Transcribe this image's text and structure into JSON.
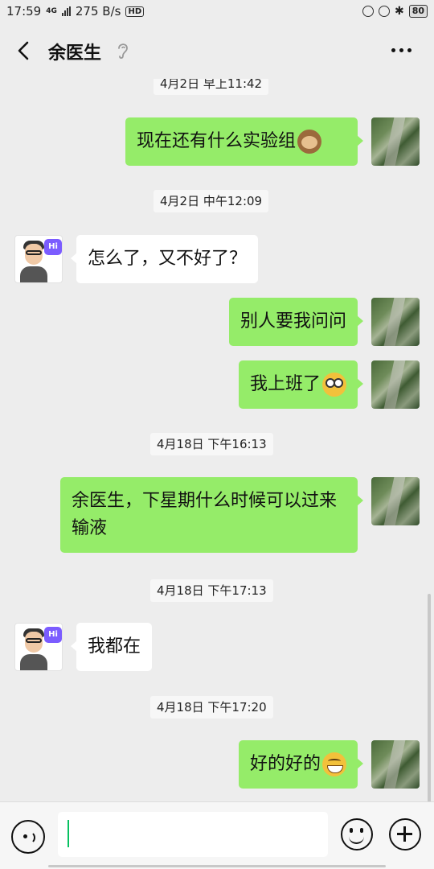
{
  "status_bar": {
    "time": "17:59",
    "network": "4G",
    "speed": "275 B/s",
    "hd": "HD",
    "battery": "80"
  },
  "header": {
    "back_icon": "chevron-left-icon",
    "title": "余医生",
    "ear_icon": "ear-icon",
    "more_icon": "more-dots-icon"
  },
  "messages": [
    {
      "type": "timestamp",
      "text": "4月2日 早上11:42"
    },
    {
      "type": "msg",
      "from": "me",
      "text": "现在还有什么实验组",
      "emoji": "see-no-evil-monkey"
    },
    {
      "type": "timestamp",
      "text": "4月2日 中午12:09"
    },
    {
      "type": "msg",
      "from": "them",
      "text": "怎么了，又不好了？"
    },
    {
      "type": "msg",
      "from": "me",
      "text": "别人要我问问"
    },
    {
      "type": "msg",
      "from": "me",
      "text": "我上班了",
      "emoji": "flushed-face"
    },
    {
      "type": "timestamp",
      "text": "4月18日 下午16:13"
    },
    {
      "type": "msg",
      "from": "me",
      "text": "余医生，下星期什么时候可以过来输液"
    },
    {
      "type": "timestamp",
      "text": "4月18日 下午17:13"
    },
    {
      "type": "msg",
      "from": "them",
      "text": "我都在"
    },
    {
      "type": "timestamp",
      "text": "4月18日 下午17:20"
    },
    {
      "type": "msg",
      "from": "me",
      "text": "好的好的",
      "emoji": "grinning-face"
    }
  ],
  "avatar_badge": "Hi",
  "input_bar": {
    "voice_icon": "voice-icon",
    "text_value": "",
    "emoji_icon": "emoji-icon",
    "plus_icon": "plus-icon"
  },
  "colors": {
    "my_bubble": "#95ec69",
    "their_bubble": "#ffffff",
    "background": "#ededed",
    "caret": "#07c160"
  }
}
